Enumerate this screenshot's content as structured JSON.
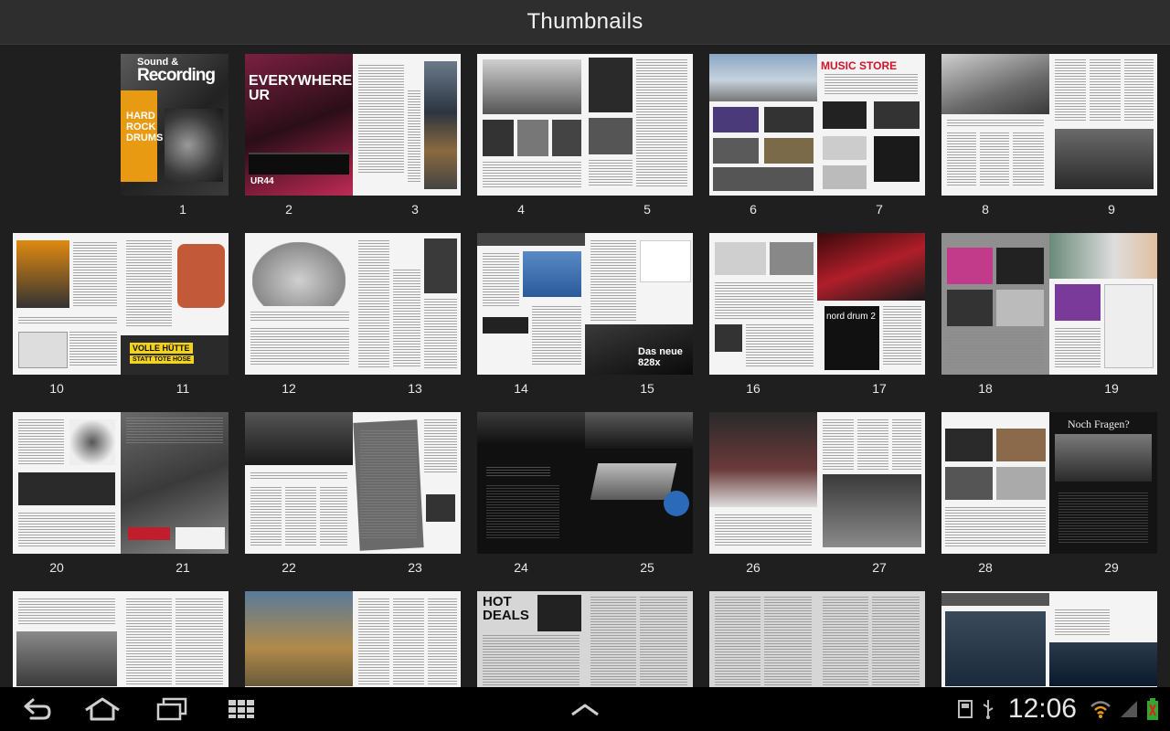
{
  "titlebar": {
    "title": "Thumbnails"
  },
  "spreads": [
    {
      "left": "",
      "right": "1"
    },
    {
      "left": "2",
      "right": "3"
    },
    {
      "left": "4",
      "right": "5"
    },
    {
      "left": "6",
      "right": "7"
    },
    {
      "left": "8",
      "right": "9"
    },
    {
      "left": "10",
      "right": "11"
    },
    {
      "left": "12",
      "right": "13"
    },
    {
      "left": "14",
      "right": "15"
    },
    {
      "left": "16",
      "right": "17"
    },
    {
      "left": "18",
      "right": "19"
    },
    {
      "left": "20",
      "right": "21"
    },
    {
      "left": "22",
      "right": "23"
    },
    {
      "left": "24",
      "right": "25"
    },
    {
      "left": "26",
      "right": "27"
    },
    {
      "left": "28",
      "right": "29"
    },
    {
      "left": "",
      "right": ""
    },
    {
      "left": "",
      "right": ""
    },
    {
      "left": "",
      "right": ""
    },
    {
      "left": "",
      "right": ""
    },
    {
      "left": "",
      "right": ""
    }
  ],
  "page_text": {
    "cover_brand_small": "Sound &",
    "cover_brand": "Recording",
    "cover_headline": "HARD ROCK DRUMS",
    "p2_headline": "EVERYWHERE UR",
    "p2_model": "UR44",
    "p6_store": "MUSIC STORE",
    "p17_model": "nord drum 2",
    "p11_banner": "VOLLE HÜTTE",
    "p11_banner2": "STATT TOTE HOSE",
    "p15_big": "Das neue 828x",
    "p29_heading": "Noch Fragen?",
    "p30_heading": "HOT DEALS"
  },
  "navbar": {
    "back_icon": "back-icon",
    "home_icon": "home-icon",
    "recents_icon": "recent-apps-icon",
    "screenshot_icon": "apps-grid-icon",
    "up_icon": "chevron-up-icon",
    "clock": "12:06"
  }
}
